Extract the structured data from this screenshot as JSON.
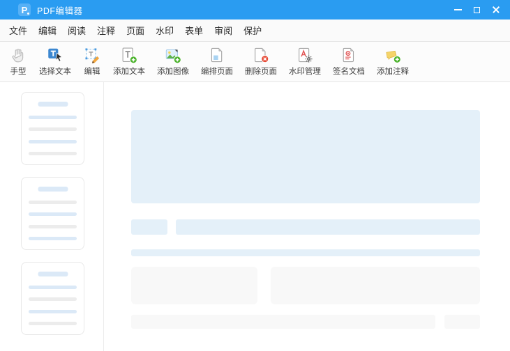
{
  "window": {
    "title": "PDF编辑器",
    "controls": [
      {
        "name": "minimize"
      },
      {
        "name": "maximize"
      },
      {
        "name": "close"
      }
    ]
  },
  "menu": {
    "items": [
      "文件",
      "编辑",
      "阅读",
      "注释",
      "页面",
      "水印",
      "表单",
      "审阅",
      "保护"
    ]
  },
  "toolbar": {
    "items": [
      {
        "label": "手型",
        "icon": "hand-icon"
      },
      {
        "label": "选择文本",
        "icon": "select-text-icon"
      },
      {
        "label": "编辑",
        "icon": "edit-icon"
      },
      {
        "label": "添加文本",
        "icon": "add-text-icon"
      },
      {
        "label": "添加图像",
        "icon": "add-image-icon"
      },
      {
        "label": "编排页面",
        "icon": "arrange-pages-icon"
      },
      {
        "label": "删除页面",
        "icon": "delete-page-icon"
      },
      {
        "label": "水印管理",
        "icon": "watermark-manage-icon"
      },
      {
        "label": "签名文档",
        "icon": "sign-document-icon"
      },
      {
        "label": "添加注释",
        "icon": "add-comment-icon"
      }
    ]
  },
  "sidebar": {
    "thumbnails": [
      {
        "lines": [
          "blue",
          "gray",
          "blue",
          "gray"
        ]
      },
      {
        "lines": [
          "gray",
          "blue",
          "gray",
          "blue"
        ]
      },
      {
        "lines": [
          "blue",
          "gray",
          "blue",
          "gray"
        ]
      }
    ]
  },
  "logo_letter": "P",
  "colors": {
    "titlebar": "#2a9cf1",
    "skeleton_blue": "#e4f0f9",
    "skeleton_gray": "#f8f8f8",
    "thumb_line_blue": "#dbe9f7",
    "thumb_line_gray": "#ececec"
  }
}
